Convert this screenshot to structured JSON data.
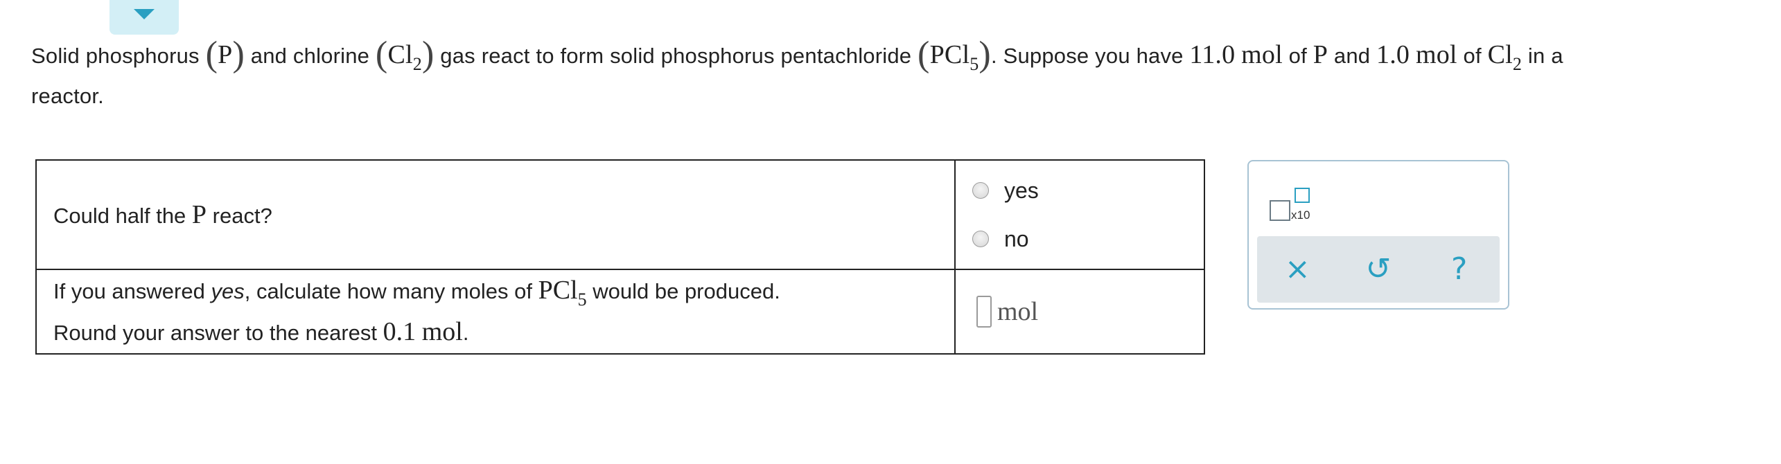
{
  "collapse_icon": "chevron-down-icon",
  "prompt": {
    "t1": "Solid phosphorus ",
    "p_symbol": "P",
    "t2": " and chlorine ",
    "cl_base": "Cl",
    "cl_sub": "2",
    "t3": " gas react to form solid phosphorus pentachloride ",
    "pcl_base": "PCl",
    "pcl_sub": "5",
    "t4": ". Suppose you have ",
    "p_amount": "11.0",
    "unit_mol": "mol",
    "t5": " of ",
    "t6": " and ",
    "cl_amount": "1.0",
    "t7": " in a",
    "t8": "reactor."
  },
  "question1": {
    "text_before": "Could half the ",
    "symbol": "P",
    "text_after": " react?",
    "options": [
      "yes",
      "no"
    ]
  },
  "question2": {
    "line1_a": "If you answered ",
    "line1_em": "yes",
    "line1_b": ", calculate how many moles of ",
    "formula_base": "PCl",
    "formula_sub": "5",
    "line1_c": " would be produced.",
    "line2_a": "Round your answer to the nearest ",
    "line2_val": "0.1",
    "line2_unit": "mol",
    "line2_end": ".",
    "input_value": "",
    "input_unit": "mol"
  },
  "palette": {
    "x10_label": "x10",
    "clear_icon": "×",
    "undo_icon": "↺",
    "help_icon": "?"
  },
  "colors": {
    "accent": "#2a9fc1",
    "tab_bg": "#d3eff6",
    "toolbar_bg": "#dfe5e9",
    "palette_border": "#a8c3d4"
  }
}
